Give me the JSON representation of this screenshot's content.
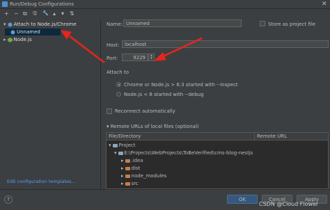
{
  "window": {
    "title": "Run/Debug Configurations"
  },
  "toolbar": {
    "add": "+",
    "remove": "−",
    "copy": "⧉",
    "save": "🖫",
    "wrench": "🔧",
    "up": "▴",
    "down": "▾",
    "sort": "⇅"
  },
  "tree": {
    "group1": "Attach to Node.js/Chrome",
    "child1": "Unnamed",
    "group2": "Node.js"
  },
  "left_footer": {
    "edit_templates": "Edit configuration templates..."
  },
  "form": {
    "name_label": "Name:",
    "name_value": "Unnamed",
    "store_label": "Store as project file",
    "host_label": "Host:",
    "host_value": "localhost",
    "port_label": "Port:",
    "port_value": "9229",
    "attach_to_label": "Attach to",
    "radio1": "Chrome or Node.js > 6.3 started with --inspect",
    "radio2": "Node.js < 8 started with --debug",
    "reconnect_label": "Reconnect automatically",
    "remote_urls_label": "Remote URLs of local files (optional)"
  },
  "url_table": {
    "col1": "File/Directory",
    "col2": "Remote URL",
    "rows": [
      {
        "label": "Project"
      },
      {
        "label": "E:\\Projects\\WebProjects\\ToBeVerified\\cms-blog-nestjs"
      },
      {
        "label": ".idea"
      },
      {
        "label": "dist"
      },
      {
        "label": "node_modules"
      },
      {
        "label": "src"
      }
    ]
  },
  "buttons": {
    "ok": "OK",
    "cancel": "Cancel",
    "apply": "Apply",
    "help": "?"
  },
  "watermark": "CSDN @Cloud Flower",
  "colors": {
    "accent": "#e8251b",
    "selection": "#0d293e",
    "link": "#589df6"
  }
}
